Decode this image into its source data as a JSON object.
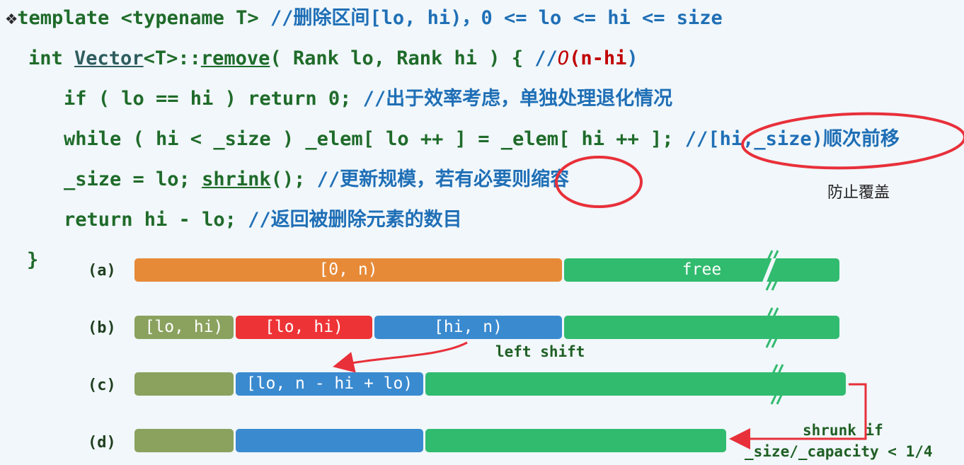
{
  "code": {
    "bullet": "❖",
    "line1": {
      "code": "template <typename T> ",
      "comment": "//删除区间[lo, hi)，0 <= lo <= hi <= size"
    },
    "line2": {
      "t1": "int ",
      "vector": "Vector",
      "t2": "<T>::",
      "remove": "remove",
      "t3": "( Rank lo, Rank hi ) { ",
      "c1": "//",
      "big_o": "O",
      "c2": "(",
      "nhi": "n-hi",
      "c3": ")"
    },
    "line3": {
      "code": "if ( lo == hi ) return 0; ",
      "comment": "//出于效率考虑，单独处理退化情况"
    },
    "line4": {
      "code": "while ( hi < _size ) _elem[ lo ++ ] = _elem[ hi ++ ]; ",
      "comment": "//[hi,_size)顺次前移"
    },
    "line5": {
      "t1": "_size = lo; ",
      "shrink": "shrink",
      "t2": "(); ",
      "comment": "//更新规模，若有必要则缩容"
    },
    "line6": {
      "code": "return hi - lo; ",
      "comment": "//返回被删除元素的数目"
    },
    "line7": "}"
  },
  "annotations": {
    "prevent_overwrite": "防止覆盖",
    "left_shift": "left shift",
    "shrunk_1": "shrunk if",
    "shrunk_2": "_size/_capacity < 1/4",
    "break_mark": "//"
  },
  "rows": {
    "a": {
      "label": "(a)",
      "s1": "[0, n)",
      "s2": "free"
    },
    "b": {
      "label": "(b)",
      "s1": "[lo, hi)",
      "s2": "[lo, hi)",
      "s3": "[hi, n)",
      "s4": ""
    },
    "c": {
      "label": "(c)",
      "s1": "",
      "s2": "[lo, n - hi + lo)",
      "s3": ""
    },
    "d": {
      "label": "(d)",
      "s1": "",
      "s2": "",
      "s3": ""
    }
  },
  "colors": {
    "orange": "#e78a38",
    "green": "#31bb6f",
    "olive": "#8aa25e",
    "red": "#ee3336",
    "blue": "#3a8ad0",
    "comment": "#1f6fb6",
    "code": "#1f6b2a",
    "highlight_circle": "#e8303a"
  }
}
